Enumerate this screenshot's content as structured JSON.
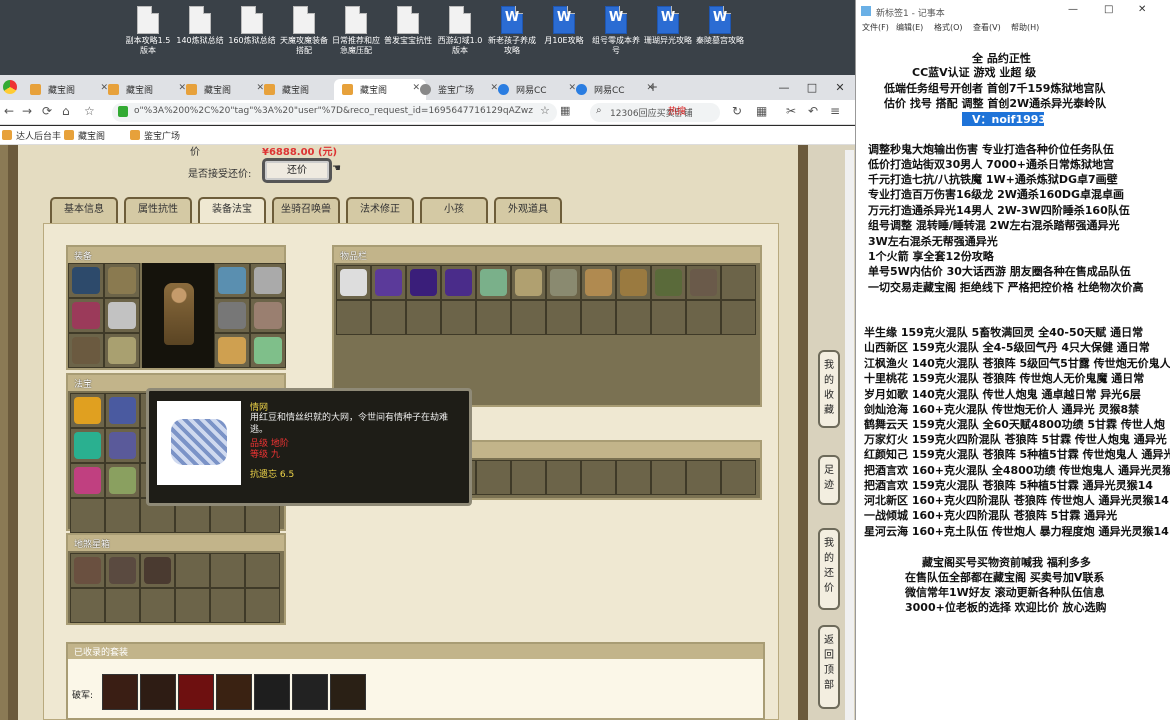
{
  "desktop": {
    "icons": [
      {
        "label": "副本攻略1.5版本",
        "type": "doc"
      },
      {
        "label": "140炼狱总结",
        "type": "doc"
      },
      {
        "label": "160炼狱总结",
        "type": "doc"
      },
      {
        "label": "天魔攻魔装备搭配",
        "type": "doc"
      },
      {
        "label": "日常推荐和应急魔压配",
        "type": "doc"
      },
      {
        "label": "普发宝宝抗性",
        "type": "doc"
      },
      {
        "label": "西游幻域1.0版本",
        "type": "doc"
      },
      {
        "label": "新老孩子养成攻略",
        "type": "word"
      },
      {
        "label": "月10E攻略",
        "type": "word"
      },
      {
        "label": "组号零成本养号",
        "type": "word"
      },
      {
        "label": "珊瑚异光攻略",
        "type": "word"
      },
      {
        "label": "秦陵墓宫攻略",
        "type": "word"
      }
    ]
  },
  "browser": {
    "tabs": [
      "藏宝阁",
      "藏宝阁",
      "藏宝阁",
      "藏宝阁",
      "藏宝阁",
      "鉴宝广场",
      "网易CC",
      "网易CC"
    ],
    "url": "o\"%3A%200%2C%20\"tag\"%3A%20\"user\"%7D&reco_request_id=1695647716129qAZwz",
    "search_text": "12306回应买卖卧铺",
    "hot_label": "热搜",
    "bookmarks": [
      "达人后台丰",
      "藏宝阁",
      "鉴宝广场"
    ],
    "window_controls": [
      "—",
      "□",
      "✕"
    ]
  },
  "game": {
    "price_label": "价",
    "price_value": "¥6888.00 (元)",
    "bargain_label": "是否接受还价:",
    "bargain_button": "还价",
    "tabs": [
      "基本信息",
      "属性抗性",
      "装备法宝",
      "坐骑召唤兽",
      "法术修正",
      "小孩",
      "外观道具"
    ],
    "equip_header": "装备",
    "inventory_header": "物品栏",
    "fabao_header": "法宝",
    "ground_header": "地煞星箱",
    "set_header": "已收录的套装",
    "set_label": "破军:",
    "tooltip": {
      "name": "情网",
      "desc": "用红豆和情丝织就的大网，令世间有情种子在劫难逃。",
      "line1": "品级  地阶",
      "line2": "等级  九",
      "stat": "抗遗忘 6.5"
    },
    "side_buttons": [
      "我的收藏",
      "足迹",
      "我的还价",
      "返回顶部"
    ]
  },
  "notepad": {
    "title": "新标签1 - 记事本",
    "menu": [
      "文件(F)",
      "编辑(E)",
      "格式(O)",
      "查看(V)",
      "帮助(H)"
    ],
    "window_controls": [
      "—",
      "□",
      "✕"
    ],
    "lines": [
      "全 品约正性",
      "CC蓝V认证  游戏  业超 级",
      "低端任务组号开创者       首创7千159炼狱地宫队",
      "估价 找号 搭配 调整       首创2W通杀异光泰岭队",
      "V：noif1993",
      "调整秒鬼大炮输出伤害       专业打造各种价位任务队伍",
      "低价打造站街双30男人        7000+通杀日常炼狱地宫",
      "千元打造七抗/八抗铁魔       1W+通杀炼狱DG卓7画壁",
      "专业打造百万伤害16级龙      2W通杀160DG卓混卓画",
      "万元打造通杀异光14男人      2W-3W四阶睡杀160队伍",
      "组号调整 混转睡/睡转混      2W左右混杀踏帮强通异光",
      "                             3W左右混杀无帮强通异光",
      "1个火箭 享全套12份攻略",
      "单号5W内估价 30大话西游      朋友圈各种在售成品队伍",
      "一切交易走藏宝阁 拒绝线下    严格把控价格 杜绝物次价高",
      "半生缘    159克火混队  5畜牧满回灵 全40-50天赋 通日常",
      "山西新区  159克火混队  全4-5级回气丹 4只大保健 通日常",
      "江枫渔火  140克火混队  苍狼阵  5级回气5甘露 传世炮无价鬼人",
      "十里桃花  159克火混队  苍狼阵  传世炮人无价鬼魔 通日常",
      "岁月如歌  140克火混队  传世人炮鬼  通卓越日常 异光6层",
      "剑灿沧海  160+克火混队  传世炮无价人  通异光  灵猴8禁",
      "鹤舞云天  159克火混队  全60天赋4800功绩 5甘霖 传世人炮",
      "万家灯火  159克火四阶混队  苍狼阵  5甘霖 传世人炮鬼 通异光",
      "红颜知己  159克火混队  苍狼阵  5种植5甘霖 传世炮鬼人 通异光",
      "把酒言欢  160+克火混队  全4800功绩 传世炮鬼人 通异光灵猴",
      "把酒言欢  159克火混队  苍狼阵  5种植5甘霖 通异光灵猴14",
      "河北新区  160+克火四阶混队  苍狼阵  传世炮人 通异光灵猴14",
      "一战倾城  160+克火四阶混队  苍狼阵  5甘霖 通异光",
      "星河云海  160+克土队伍  传世炮人  暴力程度炮 通异光灵猴14",
      "藏宝阁买号买物资前喊我 福利多多",
      "在售队伍全部都在藏宝阁 买卖号加V联系",
      "微信常年1W好友 滚动更新各种队伍信息",
      "3000+位老板的选择 欢迎比价 放心选购"
    ]
  }
}
